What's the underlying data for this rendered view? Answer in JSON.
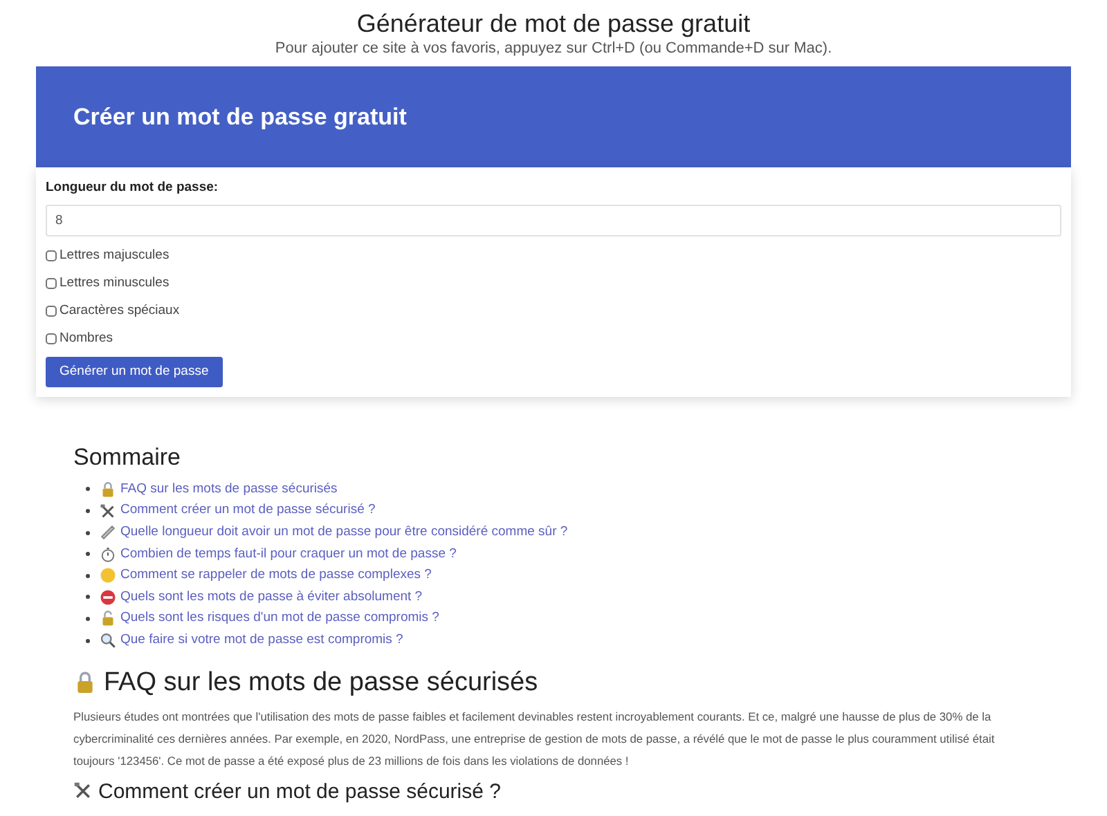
{
  "header": {
    "title": "Générateur de mot de passe gratuit",
    "subtitle": "Pour ajouter ce site à vos favoris, appuyez sur Ctrl+D (ou Commande+D sur Mac)."
  },
  "card": {
    "title": "Créer un mot de passe gratuit",
    "length_label": "Longueur du mot de passe:",
    "length_value": "8",
    "options": [
      {
        "label": "Lettres majuscules",
        "checked": false
      },
      {
        "label": "Lettres minuscules",
        "checked": false
      },
      {
        "label": "Caractères spéciaux",
        "checked": false
      },
      {
        "label": "Nombres",
        "checked": false
      }
    ],
    "button": "Générer un mot de passe"
  },
  "toc": {
    "title": "Sommaire",
    "items": [
      "FAQ sur les mots de passe sécurisés",
      "Comment créer un mot de passe sécurisé ?",
      "Quelle longueur doit avoir un mot de passe pour être considéré comme sûr ?",
      "Combien de temps faut-il pour craquer un mot de passe ?",
      "Comment se rappeler de mots de passe complexes ?",
      "Quels sont les mots de passe à éviter absolument ?",
      "Quels sont les risques d'un mot de passe compromis ?",
      "Que faire si votre mot de passe est compromis ?"
    ]
  },
  "faq": {
    "heading": "FAQ sur les mots de passe sécurisés",
    "paragraph": "Plusieurs études ont montrées que l'utilisation des mots de passe faibles et facilement devinables restent incroyablement courants. Et ce, malgré une hausse de plus de 30% de la cybercriminalité ces dernières années. Par exemple, en 2020, NordPass, une entreprise de gestion de mots de passe, a révélé que le mot de passe le plus couramment utilisé était toujours '123456'. Ce mot de passe a été exposé plus de 23 millions de fois dans les violations de données !",
    "subheading": "Comment créer un mot de passe sécurisé ?"
  }
}
